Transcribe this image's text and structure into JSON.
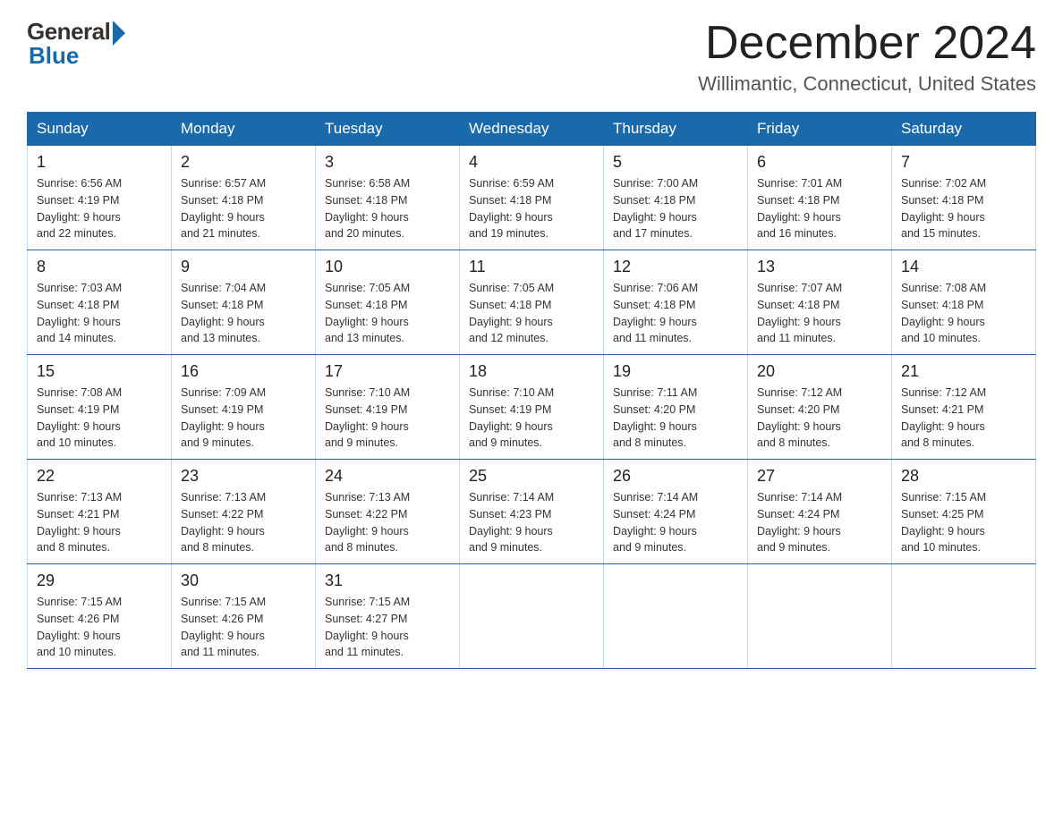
{
  "logo": {
    "general": "General",
    "blue": "Blue"
  },
  "title": {
    "month_year": "December 2024",
    "location": "Willimantic, Connecticut, United States"
  },
  "weekdays": [
    "Sunday",
    "Monday",
    "Tuesday",
    "Wednesday",
    "Thursday",
    "Friday",
    "Saturday"
  ],
  "weeks": [
    [
      {
        "day": "1",
        "sunrise": "6:56 AM",
        "sunset": "4:19 PM",
        "daylight": "9 hours and 22 minutes."
      },
      {
        "day": "2",
        "sunrise": "6:57 AM",
        "sunset": "4:18 PM",
        "daylight": "9 hours and 21 minutes."
      },
      {
        "day": "3",
        "sunrise": "6:58 AM",
        "sunset": "4:18 PM",
        "daylight": "9 hours and 20 minutes."
      },
      {
        "day": "4",
        "sunrise": "6:59 AM",
        "sunset": "4:18 PM",
        "daylight": "9 hours and 19 minutes."
      },
      {
        "day": "5",
        "sunrise": "7:00 AM",
        "sunset": "4:18 PM",
        "daylight": "9 hours and 17 minutes."
      },
      {
        "day": "6",
        "sunrise": "7:01 AM",
        "sunset": "4:18 PM",
        "daylight": "9 hours and 16 minutes."
      },
      {
        "day": "7",
        "sunrise": "7:02 AM",
        "sunset": "4:18 PM",
        "daylight": "9 hours and 15 minutes."
      }
    ],
    [
      {
        "day": "8",
        "sunrise": "7:03 AM",
        "sunset": "4:18 PM",
        "daylight": "9 hours and 14 minutes."
      },
      {
        "day": "9",
        "sunrise": "7:04 AM",
        "sunset": "4:18 PM",
        "daylight": "9 hours and 13 minutes."
      },
      {
        "day": "10",
        "sunrise": "7:05 AM",
        "sunset": "4:18 PM",
        "daylight": "9 hours and 13 minutes."
      },
      {
        "day": "11",
        "sunrise": "7:05 AM",
        "sunset": "4:18 PM",
        "daylight": "9 hours and 12 minutes."
      },
      {
        "day": "12",
        "sunrise": "7:06 AM",
        "sunset": "4:18 PM",
        "daylight": "9 hours and 11 minutes."
      },
      {
        "day": "13",
        "sunrise": "7:07 AM",
        "sunset": "4:18 PM",
        "daylight": "9 hours and 11 minutes."
      },
      {
        "day": "14",
        "sunrise": "7:08 AM",
        "sunset": "4:18 PM",
        "daylight": "9 hours and 10 minutes."
      }
    ],
    [
      {
        "day": "15",
        "sunrise": "7:08 AM",
        "sunset": "4:19 PM",
        "daylight": "9 hours and 10 minutes."
      },
      {
        "day": "16",
        "sunrise": "7:09 AM",
        "sunset": "4:19 PM",
        "daylight": "9 hours and 9 minutes."
      },
      {
        "day": "17",
        "sunrise": "7:10 AM",
        "sunset": "4:19 PM",
        "daylight": "9 hours and 9 minutes."
      },
      {
        "day": "18",
        "sunrise": "7:10 AM",
        "sunset": "4:19 PM",
        "daylight": "9 hours and 9 minutes."
      },
      {
        "day": "19",
        "sunrise": "7:11 AM",
        "sunset": "4:20 PM",
        "daylight": "9 hours and 8 minutes."
      },
      {
        "day": "20",
        "sunrise": "7:12 AM",
        "sunset": "4:20 PM",
        "daylight": "9 hours and 8 minutes."
      },
      {
        "day": "21",
        "sunrise": "7:12 AM",
        "sunset": "4:21 PM",
        "daylight": "9 hours and 8 minutes."
      }
    ],
    [
      {
        "day": "22",
        "sunrise": "7:13 AM",
        "sunset": "4:21 PM",
        "daylight": "9 hours and 8 minutes."
      },
      {
        "day": "23",
        "sunrise": "7:13 AM",
        "sunset": "4:22 PM",
        "daylight": "9 hours and 8 minutes."
      },
      {
        "day": "24",
        "sunrise": "7:13 AM",
        "sunset": "4:22 PM",
        "daylight": "9 hours and 8 minutes."
      },
      {
        "day": "25",
        "sunrise": "7:14 AM",
        "sunset": "4:23 PM",
        "daylight": "9 hours and 9 minutes."
      },
      {
        "day": "26",
        "sunrise": "7:14 AM",
        "sunset": "4:24 PM",
        "daylight": "9 hours and 9 minutes."
      },
      {
        "day": "27",
        "sunrise": "7:14 AM",
        "sunset": "4:24 PM",
        "daylight": "9 hours and 9 minutes."
      },
      {
        "day": "28",
        "sunrise": "7:15 AM",
        "sunset": "4:25 PM",
        "daylight": "9 hours and 10 minutes."
      }
    ],
    [
      {
        "day": "29",
        "sunrise": "7:15 AM",
        "sunset": "4:26 PM",
        "daylight": "9 hours and 10 minutes."
      },
      {
        "day": "30",
        "sunrise": "7:15 AM",
        "sunset": "4:26 PM",
        "daylight": "9 hours and 11 minutes."
      },
      {
        "day": "31",
        "sunrise": "7:15 AM",
        "sunset": "4:27 PM",
        "daylight": "9 hours and 11 minutes."
      },
      null,
      null,
      null,
      null
    ]
  ],
  "labels": {
    "sunrise": "Sunrise: ",
    "sunset": "Sunset: ",
    "daylight": "Daylight: "
  }
}
